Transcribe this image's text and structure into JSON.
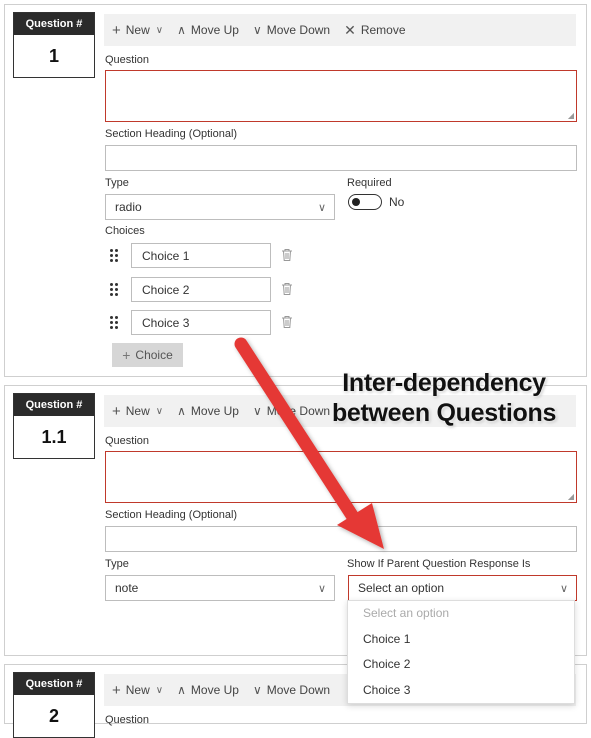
{
  "toolbar": {
    "new_label": "New",
    "move_up_label": "Move Up",
    "move_down_label": "Move Down",
    "remove_label": "Remove"
  },
  "question_box_header": "Question #",
  "cards": [
    {
      "number": "1",
      "question_label": "Question",
      "question_value": "",
      "section_heading_label": "Section Heading (Optional)",
      "section_heading_value": "",
      "type_label": "Type",
      "type_value": "radio",
      "required_label": "Required",
      "required_value": "No",
      "choices_label": "Choices",
      "choices": [
        "Choice 1",
        "Choice 2",
        "Choice 3"
      ],
      "add_choice_label": "Choice"
    },
    {
      "number": "1.1",
      "question_label": "Question",
      "question_value": "",
      "section_heading_label": "Section Heading (Optional)",
      "section_heading_value": "",
      "type_label": "Type",
      "type_value": "note",
      "show_if_label": "Show If Parent Question Response Is",
      "show_if_value": "Select an option"
    },
    {
      "number": "2",
      "question_label": "Question"
    }
  ],
  "show_if_dropdown": {
    "options": [
      "Select an option",
      "Choice 1",
      "Choice 2",
      "Choice 3"
    ]
  },
  "annotation": {
    "line1": "Inter-dependency",
    "line2": "between Questions",
    "arrow_color": "#e53935"
  },
  "colors": {
    "error_border": "#c0392b",
    "header_dark": "#2b2b2b",
    "toolbar_bg": "#f1f1f1"
  }
}
